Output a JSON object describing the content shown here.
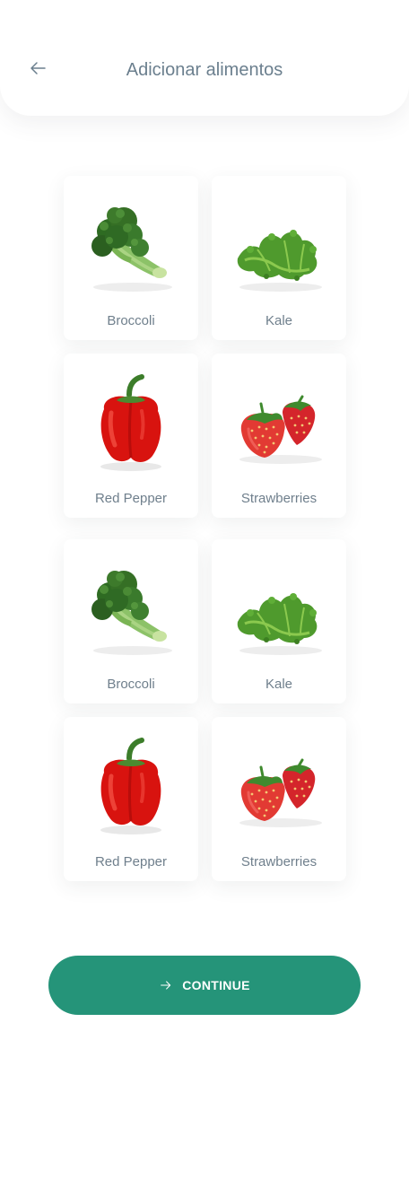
{
  "header": {
    "title": "Adicionar alimentos",
    "back_icon": "arrow-left-icon"
  },
  "foods": [
    {
      "label": "Broccoli",
      "icon": "broccoli"
    },
    {
      "label": "Kale",
      "icon": "kale"
    },
    {
      "label": "Red Pepper",
      "icon": "red-pepper"
    },
    {
      "label": "Strawberries",
      "icon": "strawberries"
    },
    {
      "label": "Broccoli",
      "icon": "broccoli"
    },
    {
      "label": "Kale",
      "icon": "kale"
    },
    {
      "label": "Red Pepper",
      "icon": "red-pepper"
    },
    {
      "label": "Strawberries",
      "icon": "strawberries"
    }
  ],
  "actions": {
    "continue_label": "CONTINUE",
    "continue_icon": "arrow-right-icon"
  },
  "colors": {
    "accent": "#259479",
    "title": "#6b7f8e",
    "label": "#6f7f8c",
    "background": "#ffffff"
  }
}
